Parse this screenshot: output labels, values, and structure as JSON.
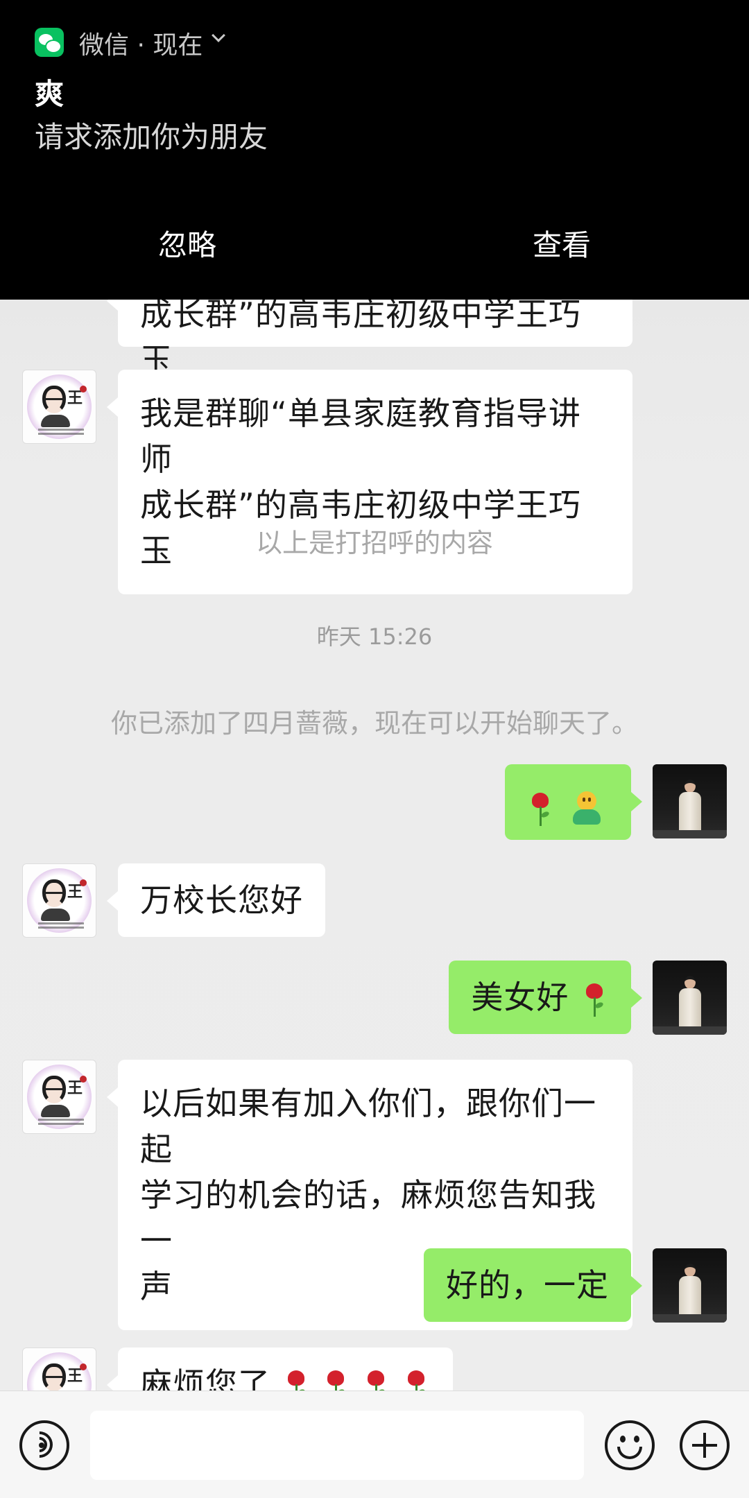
{
  "notification": {
    "app_label": "微信 · 现在",
    "title": "爽",
    "body": "请求添加你为朋友",
    "ignore_label": "忽略",
    "view_label": "查看"
  },
  "chat": {
    "greeting_partial": "成长群”的高韦庄初级中学王巧玉",
    "greeting_line1": "我是群聊“单县家庭教育指导讲师",
    "greeting_line2": "成长群”的高韦庄初级中学王巧玉",
    "greeting_note": "以上是打招呼的内容",
    "timestamp": "昨天 15:26",
    "added_note": "你已添加了四月蔷薇，现在可以开始聊天了。",
    "messages": [
      {
        "side": "out",
        "text": ""
      },
      {
        "side": "in",
        "text": "万校长您好"
      },
      {
        "side": "out",
        "text": "美女好"
      },
      {
        "side": "in",
        "line1": "以后如果有加入你们，跟你们一起",
        "line2": "学习的机会的话，麻烦您告知我一",
        "line3": "声"
      },
      {
        "side": "out",
        "text": "好的，一定"
      },
      {
        "side": "in",
        "text": "麻烦您了"
      }
    ]
  },
  "avatars": {
    "contact_glyph": "王"
  },
  "icons": {
    "voice": "voice-icon",
    "emoji": "emoji-icon",
    "plus": "plus-icon",
    "wechat": "wechat-icon",
    "rose": "rose-emoji",
    "smile": "smile-emoji"
  },
  "colors": {
    "incoming_bubble": "#ffffff",
    "outgoing_bubble": "#95ec69",
    "chat_background": "#ededed",
    "notification_background": "#000000",
    "wechat_green": "#09c160"
  }
}
